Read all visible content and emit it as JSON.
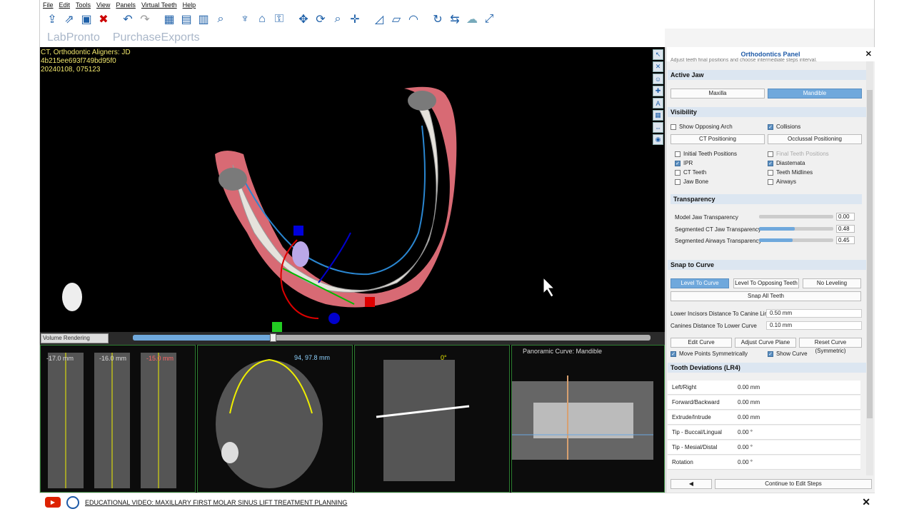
{
  "menu": [
    "File",
    "Edit",
    "Tools",
    "View",
    "Panels",
    "Virtual Teeth",
    "Help"
  ],
  "brand": {
    "left": "LabPronto",
    "right": "PurchaseExports"
  },
  "patient": {
    "line1": "CT, Orthodontic Aligners: JD",
    "line2": "4b215ee693f749bd95f0",
    "line3": "20240108, 075123"
  },
  "render_mode": "Volume Rendering",
  "slider3d": {
    "fraction": 0.27
  },
  "lower": {
    "slices": [
      "-17.0 mm",
      "-16.0 mm",
      "-15.0 mm"
    ],
    "axial_coord": "94, 97.8 mm",
    "sagittal_angle": "0°",
    "panoramic_title": "Panoramic Curve: Mandible"
  },
  "panel": {
    "title": "Orthodontics Panel",
    "subtitle": "Adjust teeth final positions and choose intermediate steps interval.",
    "active_jaw": {
      "header": "Active Jaw",
      "maxilla": "Maxilla",
      "mandible": "Mandible"
    },
    "visibility": {
      "header": "Visibility",
      "show_opposing": "Show Opposing Arch",
      "collisions": "Collisions",
      "ct_positioning": "CT Positioning",
      "occlusal_positioning": "Occlussal Positioning",
      "initial_teeth": "Initial Teeth Positions",
      "final_teeth": "Final Teeth Positions",
      "ipr": "IPR",
      "diastemata": "Diastemata",
      "ct_teeth": "CT Teeth",
      "teeth_midlines": "Teeth Midlines",
      "jaw_bone": "Jaw Bone",
      "airways": "Airways"
    },
    "transparency": {
      "header": "Transparency",
      "rows": [
        {
          "label": "Model Jaw Transparency",
          "value": "0.00",
          "level": 0.0
        },
        {
          "label": "Segmented CT Jaw Transparency",
          "value": "0.48",
          "level": 0.48
        },
        {
          "label": "Segmented Airways Transparency",
          "value": "0.45",
          "level": 0.45
        }
      ]
    },
    "snap": {
      "header": "Snap to Curve",
      "level_to_curve": "Level To Curve",
      "level_to_opposing": "Level To Opposing Teeth",
      "no_leveling": "No Leveling",
      "snap_all": "Snap All Teeth",
      "lower_incisors_label": "Lower Incisors Distance To Canine Line",
      "lower_incisors_value": "0.50 mm",
      "canines_label": "Canines Distance To Lower Curve",
      "canines_value": "0.10 mm",
      "edit_curve": "Edit Curve",
      "adjust_curve_plane": "Adjust Curve Plane",
      "reset_curve": "Reset Curve (Symmetric)",
      "move_points": "Move Points Symmetrically",
      "show_curve": "Show Curve"
    },
    "deviations": {
      "header": "Tooth Deviations (LR4)",
      "rows": [
        {
          "label": "Left/Right",
          "value": "0.00 mm"
        },
        {
          "label": "Forward/Backward",
          "value": "0.00 mm"
        },
        {
          "label": "Extrude/Intrude",
          "value": "0.00 mm"
        },
        {
          "label": "Tip - Buccal/Lingual",
          "value": "0.00 °"
        },
        {
          "label": "Tip - Mesial/Distal",
          "value": "0.00 °"
        },
        {
          "label": "Rotation",
          "value": "0.00 °"
        }
      ]
    },
    "continue": "Continue to Edit Steps"
  },
  "video_caption": "EDUCATIONAL VIDEO: MAXILLARY FIRST MOLAR SINUS LIFT TREATMENT PLANNING"
}
